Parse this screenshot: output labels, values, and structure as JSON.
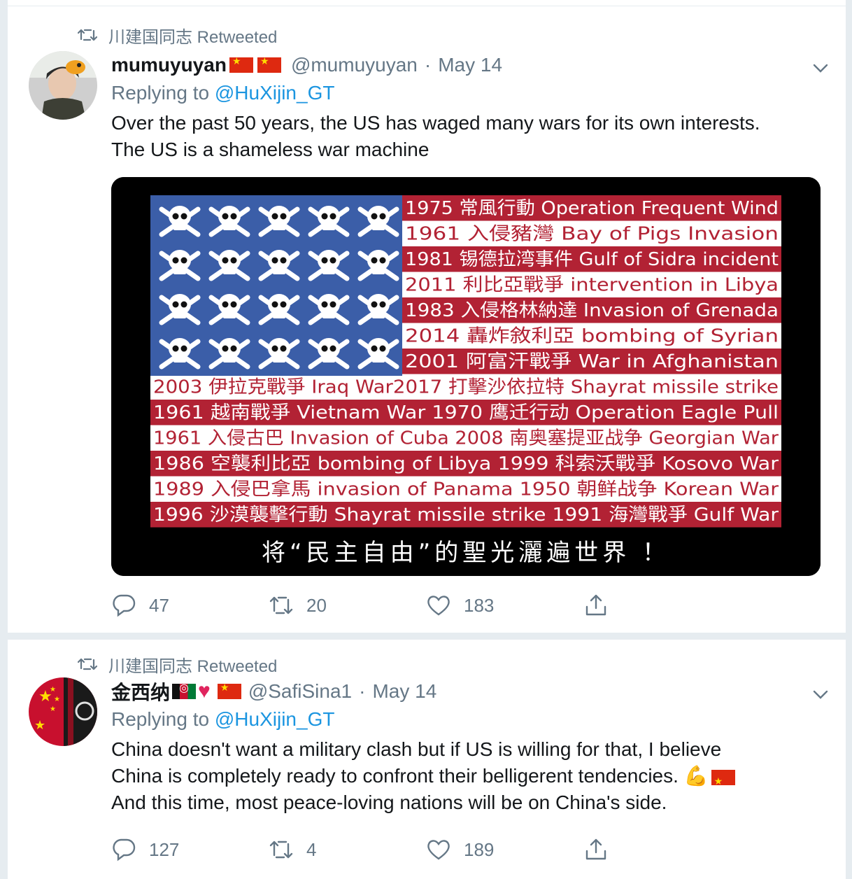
{
  "tweets": [
    {
      "retweeted_by": "川建国同志 Retweeted",
      "name": "mumuyuyan",
      "handle": "@mumuyuyan",
      "separator": "·",
      "date": "May 14",
      "replying_prefix": "Replying to",
      "replying_to": "@HuXijin_GT",
      "text": "Over the past 50 years, the US has waged many wars for its own interests.\nThe US is a shameless war machine",
      "media": {
        "rows": [
          "1975 常風行動 Operation Frequent Wind",
          "1961 入侵豬灣 Bay of Pigs Invasion",
          "1981 锡德拉湾事件 Gulf of Sidra incident",
          "2011 利比亞戰爭 intervention in Libya",
          "1983 入侵格林納達 Invasion of Grenada",
          "2014 轟炸敘利亞 bombing of Syrian",
          "2001 阿富汗戰爭 War in Afghanistan",
          "2003 伊拉克戰爭 Iraq War2017 打擊沙依拉特  Shayrat missile strike",
          "1961 越南戰爭 Vietnam War   1970 鹰迁行动 Operation Eagle Pull",
          "1961 入侵古巴 Invasion of Cuba 2008 南奥塞提亚战争 Georgian War",
          "1986 空襲利比亞 bombing of Libya 1999 科索沃戰爭 Kosovo War",
          "1989 入侵巴拿馬 invasion of Panama   1950 朝鲜战争 Korean War",
          "1996 沙漠襲擊行動 Shayrat missile strike   1991 海灣戰爭 Gulf War"
        ],
        "caption": "将“民主自由”的聖光灑遍世界 ！"
      },
      "replies": "47",
      "retweets": "20",
      "likes": "183"
    },
    {
      "retweeted_by": "川建国同志 Retweeted",
      "name": "金西纳",
      "handle": "@SafiSina1",
      "separator": "·",
      "date": "May 14",
      "replying_prefix": "Replying to",
      "replying_to": "@HuXijin_GT",
      "text_line_1": "China doesn't want a military clash but if US is willing for that, I believe",
      "text_line_2": "China is completely ready to confront their belligerent tendencies.",
      "text_line_3": "And this time, most peace-loving nations will be on China's side.",
      "emoji_muscle": "💪",
      "replies": "127",
      "retweets": "4",
      "likes": "189"
    }
  ],
  "colors": {
    "accent": "#1b95e0",
    "muted": "#657786",
    "stripe_red": "#b22234"
  },
  "icons": [
    "retweet-icon",
    "chevron-down-icon",
    "reply-icon",
    "like-icon",
    "share-icon"
  ]
}
